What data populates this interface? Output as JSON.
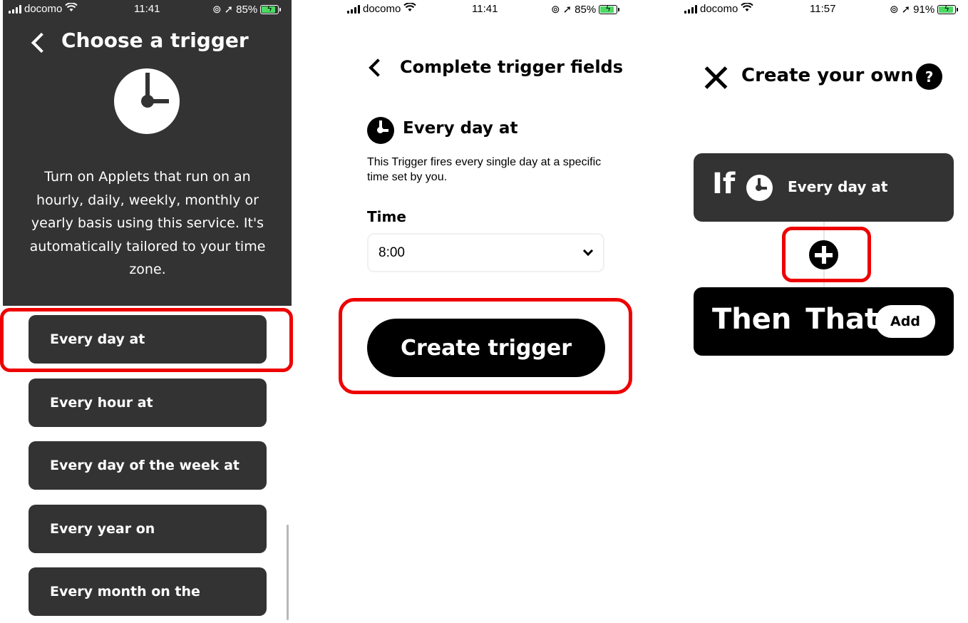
{
  "status_bars": [
    {
      "carrier": "docomo",
      "time": "11:41",
      "battery": "85%"
    },
    {
      "carrier": "docomo",
      "time": "11:41",
      "battery": "85%"
    },
    {
      "carrier": "docomo",
      "time": "11:57",
      "battery": "91%"
    }
  ],
  "choose": {
    "title": "Choose a trigger",
    "description": "Turn on Applets that run on an hourly, daily, weekly, monthly or yearly basis using this service. It's automatically tailored to your time zone.",
    "triggers": [
      "Every day at",
      "Every hour at",
      "Every day of the week at",
      "Every year on",
      "Every month on the"
    ]
  },
  "complete": {
    "title": "Complete trigger fields",
    "trigger_name": "Every day at",
    "description": "This Trigger fires every single day at a specific time set by you.",
    "time_label": "Time",
    "time_value": "8:00",
    "create_button": "Create trigger"
  },
  "create_own": {
    "title": "Create your own",
    "help": "?",
    "if_label": "If",
    "if_trigger": "Every day at",
    "then_label": "Then That",
    "add_button": "Add"
  },
  "colors": {
    "dark_panel": "#333333",
    "highlight": "#ee0000",
    "battery": "#4cd964"
  }
}
